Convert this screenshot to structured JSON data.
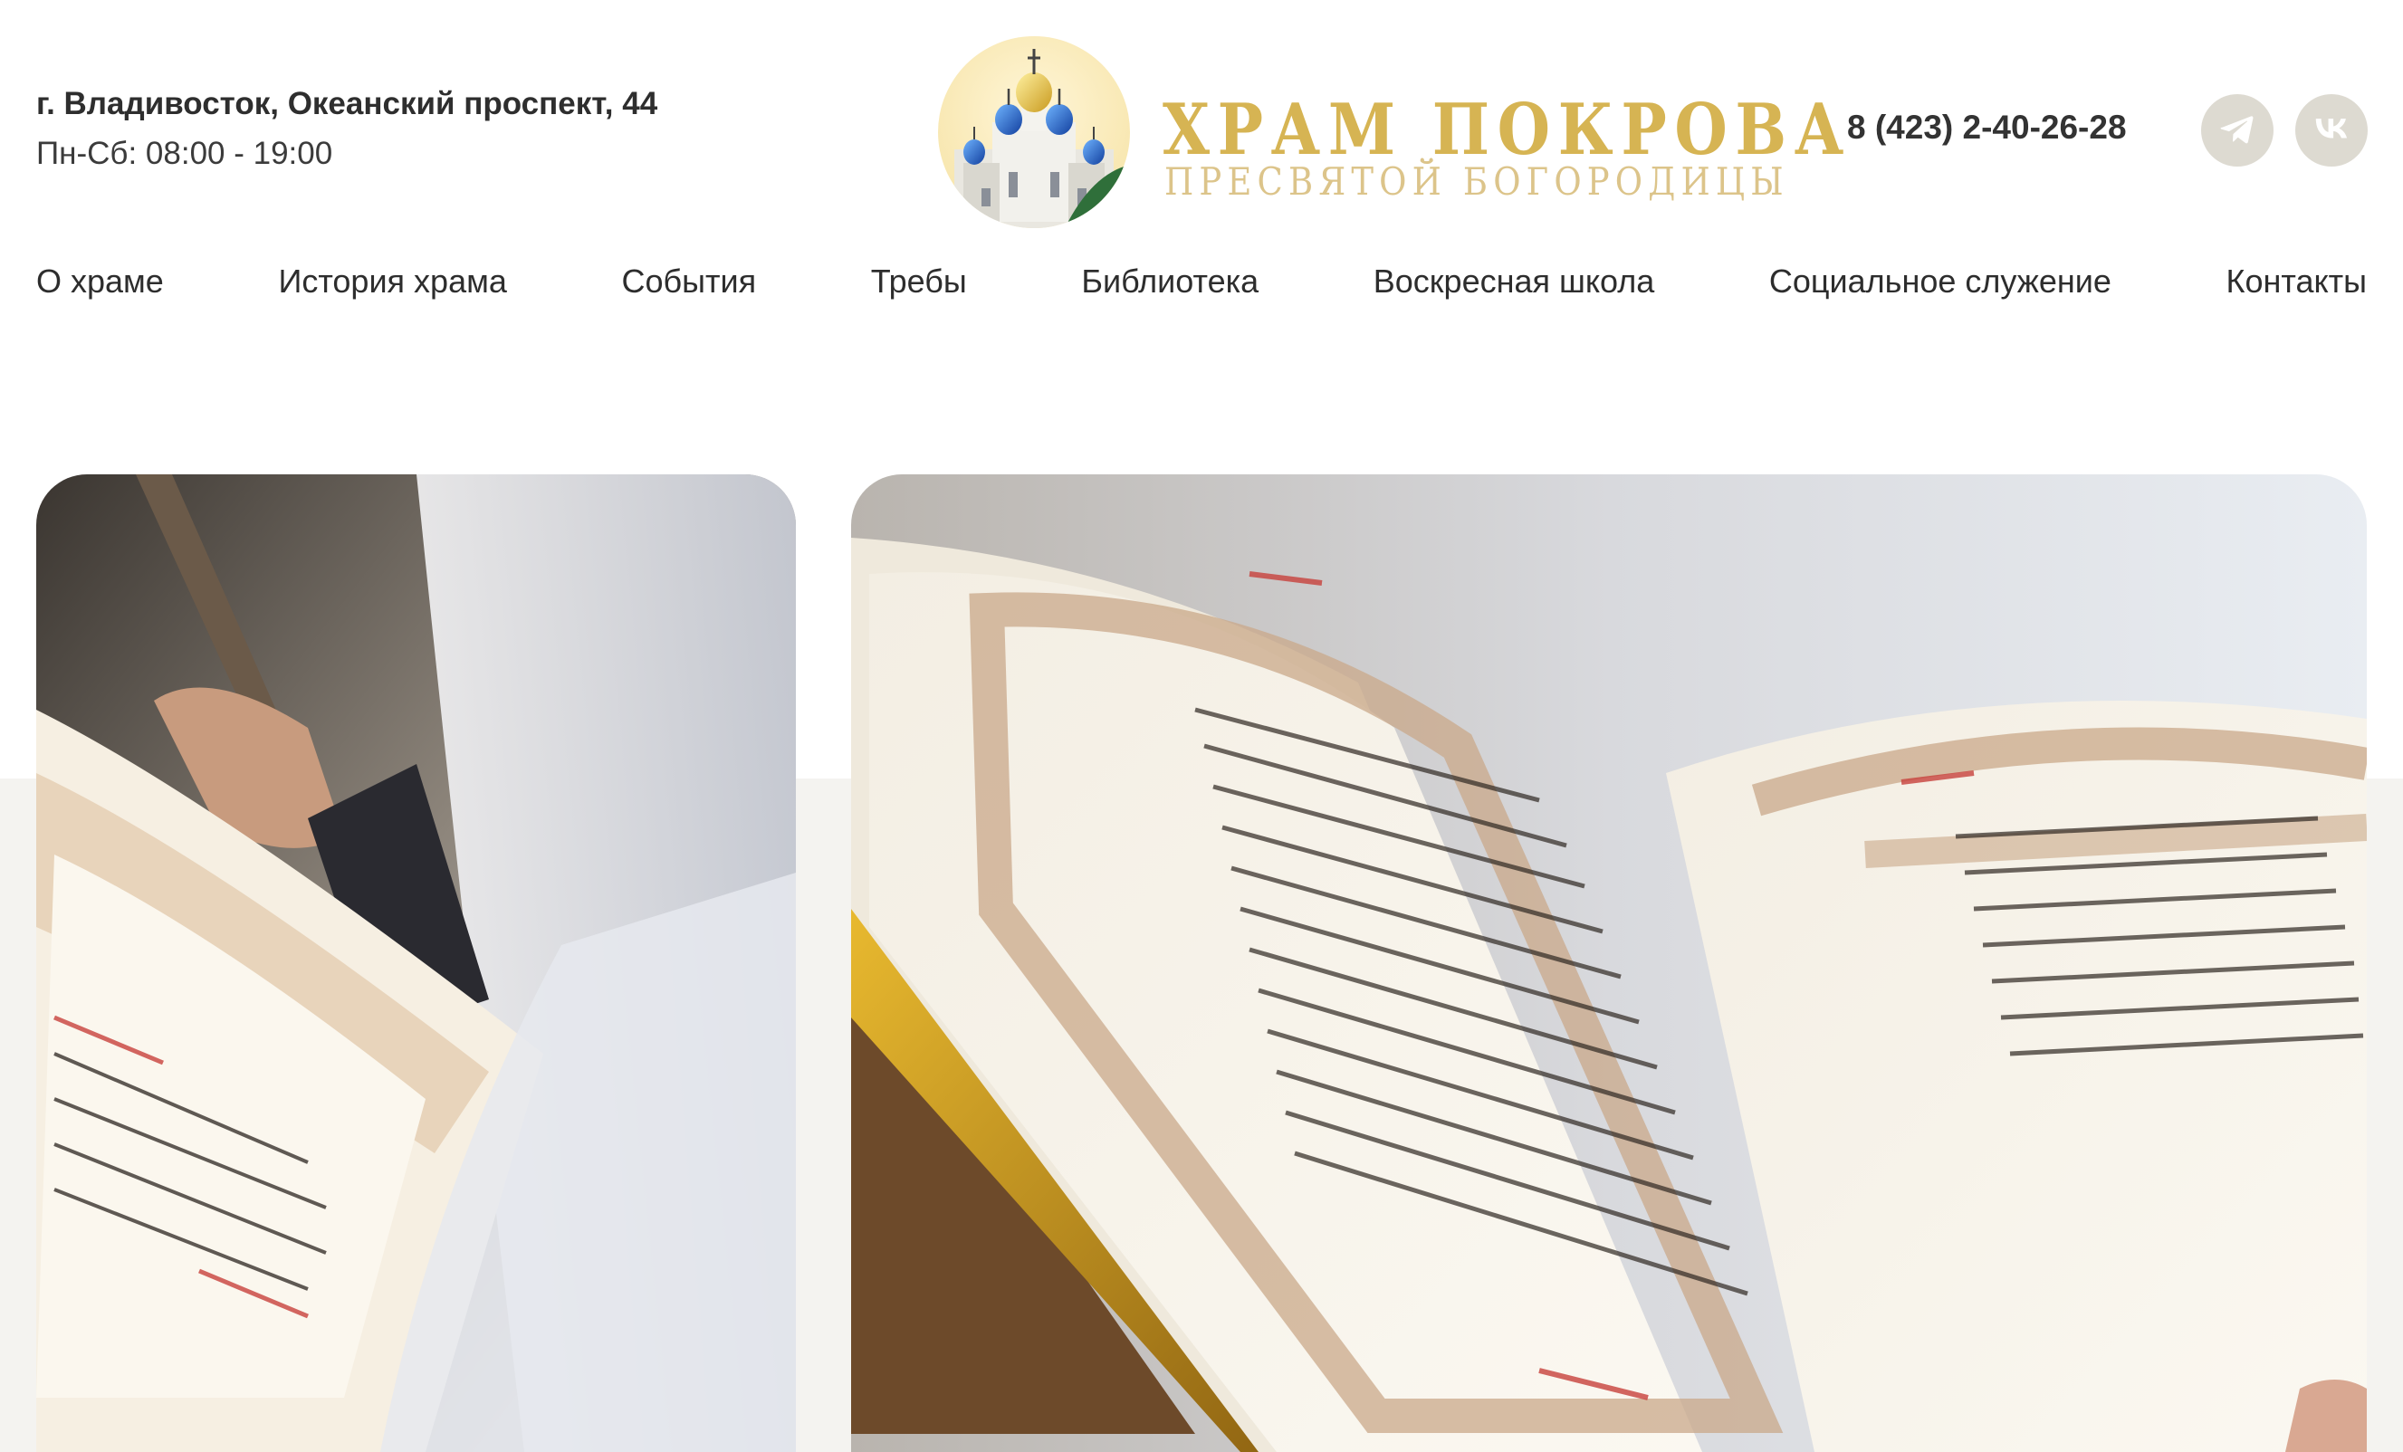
{
  "header": {
    "address": "г. Владивосток, Океанский проспект, 44",
    "hours": "Пн-Сб: 08:00 - 19:00",
    "logo": {
      "title": "ХРАМ ПОКРОВА",
      "subtitle": "ПРЕСВЯТОЙ БОГОРОДИЦЫ"
    },
    "phone": "8 (423) 2-40-26-28",
    "social": [
      {
        "icon": "telegram-icon"
      },
      {
        "icon": "vk-icon"
      }
    ]
  },
  "nav": {
    "items": [
      {
        "label": "О храме"
      },
      {
        "label": "История храма"
      },
      {
        "label": "События"
      },
      {
        "label": "Требы"
      },
      {
        "label": "Библиотека"
      },
      {
        "label": "Воскресная школа"
      },
      {
        "label": "Социальное служение"
      },
      {
        "label": "Контакты"
      }
    ]
  },
  "colors": {
    "gold": "#d6b453",
    "gold_light": "#dcc48a",
    "social_bg": "#dddad1",
    "text": "#2d2d2d",
    "band": "#f4f3f0"
  }
}
